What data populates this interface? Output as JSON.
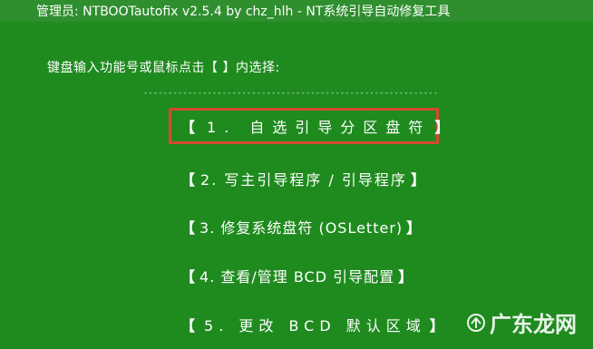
{
  "window": {
    "title": "管理员:  NTBOOTautofix v2.5.4 by chz_hlh - NT系统引导自动修复工具"
  },
  "console": {
    "prompt": "键盘输入功能号或鼠标点击【 】内选择:",
    "separator": "------------------------------------------------------------"
  },
  "menu": {
    "items": [
      {
        "open": "【",
        "text": "1. 自选引导分区盘符",
        "close": "】",
        "selected": true
      },
      {
        "open": "【",
        "text": "2. 写主引导程序 / 引导程序",
        "close": "】"
      },
      {
        "open": "【",
        "text": "3. 修复系统盘符 (OSLetter)",
        "close": "】"
      },
      {
        "open": "【",
        "text": "4. 查看/管理 BCD 引导配置 ",
        "close": "】"
      },
      {
        "open": "【",
        "text": "5. 更改 BCD 默认区域 ",
        "close": "】"
      }
    ],
    "highlight_color": "#d64a2c"
  },
  "watermark": {
    "text": "广东龙网"
  },
  "colors": {
    "background": "#1f8b1f",
    "titlebar": "#2f8f2f",
    "text": "#ffffff"
  }
}
